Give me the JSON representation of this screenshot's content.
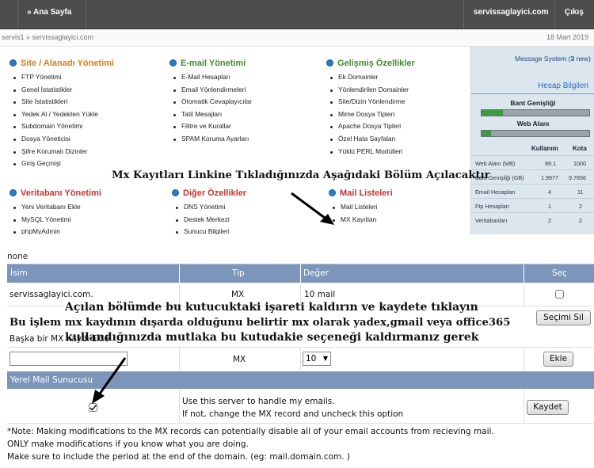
{
  "topbar": {
    "home": "» Ana Sayfa",
    "domain": "servissaglayici.com",
    "logout": "Çıkış"
  },
  "crumbs": {
    "path": "servis1 » servissaglayici.com",
    "date": "18 Mart 2019"
  },
  "sections": {
    "site": {
      "title": "Site / Alanadı Yönetimi",
      "items": [
        "FTP Yönetimi",
        "Genel İstatistikler",
        "Site İstatistikleri",
        "Yedek Al / Yedekten Yükle",
        "Subdomain Yönetimi",
        "Dosya Yöneticisi",
        "Şifre Korumalı Dizinler",
        "Giriş Geçmişi"
      ]
    },
    "email": {
      "title": "E-mail Yönetimi",
      "items": [
        "E-Mail Hesapları",
        "Email Yönlendirmeleri",
        "Otomatik Cevaplayıcılar",
        "Tatil Mesajları",
        "Filitre ve Kurallar",
        "SPAM Koruma Ayarları"
      ]
    },
    "advanced": {
      "title": "Gelişmiş Özellikler",
      "items": [
        "Ek Domainler",
        "Yönlendirilen Domainler",
        "Site/Dizin Yönlendirme",
        "Mime Dosya Tipleri",
        "Apache Dosya Tipleri",
        "Özel Hata Sayfaları",
        "Yüklü PERL Modülleri"
      ]
    },
    "db": {
      "title": "Veritabanı Yönetimi",
      "items": [
        "Yeni Veritabanı Ekle",
        "MySQL Yönetimi",
        "phpMyAdmin"
      ]
    },
    "other": {
      "title": "Diğer Özellikler",
      "items": [
        "DNS Yönetimi",
        "Destek Merkezi",
        "Sunucu Bilgileri"
      ]
    },
    "mail": {
      "title": "Mail Listeleri",
      "items": [
        "Mail Listeleri",
        "MX Kayıtları"
      ]
    }
  },
  "side": {
    "message_label": "Message System (",
    "message_count": "3",
    "message_suffix": " new)",
    "account_title": "Hesap Bilgileri",
    "bandwidth_label": "Bant Genişliği",
    "bandwidth_fill": 0.2,
    "web_label": "Web Alanı",
    "web_fill": 0.09,
    "col_used": "Kullanım",
    "col_quota": "Kota",
    "rows": [
      {
        "label": "Web Alanı (MB)",
        "used": "89.1",
        "quota": "1000"
      },
      {
        "label": "Bant Genişliği (GB)",
        "used": "1.9977",
        "quota": "9.7656"
      },
      {
        "label": "Email Hesapları",
        "used": "4",
        "quota": "11"
      },
      {
        "label": "Ftp Hesapları",
        "used": "1",
        "quota": "2"
      },
      {
        "label": "Veritabanları",
        "used": "2",
        "quota": "2"
      }
    ]
  },
  "annotations": {
    "top_caption": "Mx Kayıtları Linkine Tıkladığınızda Aşağıdaki Bölüm Açılacaktır",
    "line1": "Açılan bölümde bu kutucuktaki işareti kaldırın ve kaydete tıklayın",
    "line2": "Bu işlem mx kaydının dışarda olduğunu belirtir mx olarak yadex,gmail veya office365",
    "line3": "kullandığınızda mutlaka bu kutudakie seçeneği kaldırmanız gerek"
  },
  "mx": {
    "none_label": "none",
    "col_name": "İsim",
    "col_type": "Tip",
    "col_value": "Değer",
    "col_select": "Seç",
    "record_name": "servissaglayici.com.",
    "record_type": "MX",
    "record_value": "10 mail",
    "select_all_button": "Seçimi Sil",
    "other_label": "Başka bir MX Kaydı Ekle",
    "new_type": "MX",
    "priority_value": "10",
    "add_button": "Ekle",
    "local_mail_title": "Yerel Mail Sunucusu",
    "use_server_line1": "Use this server to handle my emails.",
    "use_server_line2": "If not, change the MX record and uncheck this option",
    "save_button": "Kaydet",
    "note1": "*Note: Making modifications to the MX records can potentially disable all of your email accounts from recieving mail.",
    "note2": "ONLY make modifications if you know what you are doing.",
    "note3": "Make sure to include the period at the end of the domain. (eg: mail.domain.com. )"
  }
}
